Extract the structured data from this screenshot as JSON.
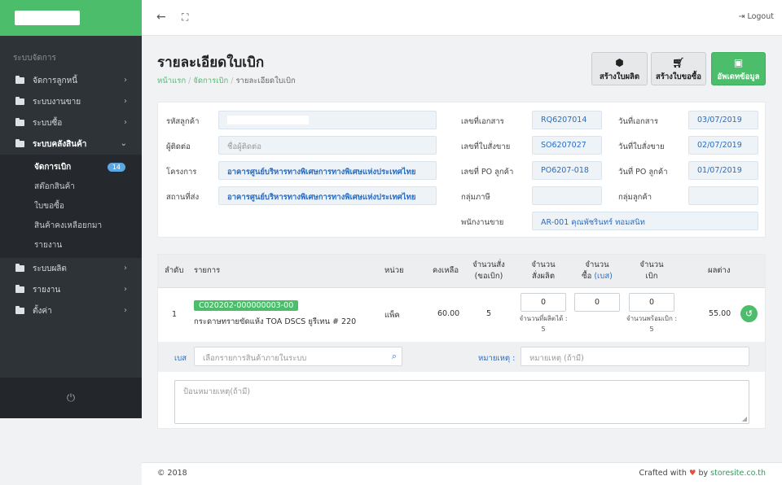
{
  "sidebar": {
    "heading": "ระบบจัดการ",
    "items": [
      {
        "label": "จัดการลูกหนี้"
      },
      {
        "label": "ระบบงานขาย"
      },
      {
        "label": "ระบบซื้อ"
      },
      {
        "label": "ระบบคลังสินค้า"
      },
      {
        "label": "ระบบผลิต"
      },
      {
        "label": "รายงาน"
      },
      {
        "label": "ตั้งค่า"
      }
    ],
    "subitems": [
      {
        "label": "จัดการเบิก",
        "badge": "14"
      },
      {
        "label": "สต๊อกสินค้า"
      },
      {
        "label": "ใบขอซื้อ"
      },
      {
        "label": "สินค้าคงเหลือยกมา"
      },
      {
        "label": "รายงาน"
      }
    ]
  },
  "topbar": {
    "logout": "Logout"
  },
  "page": {
    "title": "รายละเอียดใบเบิก",
    "breadcrumb": [
      "หน้าแรก",
      "จัดการเบิก",
      "รายละเอียดใบเบิก"
    ],
    "buttons": {
      "create_production": "สร้างใบผลิต",
      "create_purchase": "สร้างใบขอซื้อ",
      "update": "อัพเดทข้อมูล"
    }
  },
  "form": {
    "customer_code_label": "รหัสลูกค้า",
    "contact_label": "ผู้ติดต่อ",
    "contact_placeholder": "ชื่อผู้ติดต่อ",
    "project_label": "โครงการ",
    "project_value": "อาคารศูนย์บริหารทางพิเศษการทางพิเศษแห่งประเทศไทย",
    "ship_label": "สถานที่ส่ง",
    "ship_value": "อาคารศูนย์บริหารทางพิเศษการทางพิเศษแห่งประเทศไทย",
    "doc_no_label": "เลขที่เอกสาร",
    "doc_no": "RQ6207014",
    "doc_date_label": "วันที่เอกสาร",
    "doc_date": "03/07/2019",
    "so_no_label": "เลขที่ใบสั่งขาย",
    "so_no": "SO6207027",
    "so_date_label": "วันที่ใบสั่งขาย",
    "so_date": "02/07/2019",
    "po_no_label": "เลขที่ PO ลูกค้า",
    "po_no": "PO6207-018",
    "po_date_label": "วันที่ PO ลูกค้า",
    "po_date": "01/07/2019",
    "tax_group_label": "กลุ่มภาษี",
    "customer_group_label": "กลุ่มลูกค้า",
    "salesperson_label": "พนักงานขาย",
    "salesperson": "AR-001 คุณพัชรินทร์ ทอมสนิท"
  },
  "table": {
    "headers": {
      "no": "ลำดับ",
      "item": "รายการ",
      "unit": "หน่วย",
      "remaining": "คงเหลือ",
      "ordered_1": "จำนวนสั่ง",
      "ordered_2": "(ขอเบิก)",
      "produce_1": "จำนวน",
      "produce_2": "สั่งผลิต",
      "buy_1": "จำนวน",
      "buy_2": "ซื้อ",
      "buy_3": "(เบส)",
      "withdraw_1": "จำนวน",
      "withdraw_2": "เบิก",
      "diff": "ผลต่าง"
    },
    "rows": [
      {
        "no": "1",
        "code": "C020202-000000003-00",
        "name": "กระดาษทรายขัดแห้ง TOA DSCS ยูรีเทน # 220",
        "unit": "แพ็ค",
        "remaining": "60.00",
        "ordered": "5",
        "produce": "0",
        "produce_note_1": "จำนวนที่ผลิตได้ :",
        "produce_note_2": "5",
        "buy": "0",
        "withdraw": "0",
        "withdraw_note_1": "จำนวนพร้อมเบิก :",
        "withdraw_note_2": "5",
        "diff": "55.00"
      }
    ]
  },
  "add_row": {
    "label": "เบส",
    "search_placeholder": "เลือกรายการสินค้าภายในระบบ",
    "remark_label": "หมายเหตุ :",
    "remark_placeholder": "หมายเหตุ (ถ้ามี)"
  },
  "note_placeholder": "ป้อนหมายเหตุ(ถ้ามี)",
  "footer": {
    "copyright": "© 2018",
    "crafted": "Crafted with",
    "by": "by",
    "site": "storesite.co.th"
  },
  "colors": {
    "brand": "#4cbe6b",
    "sidebar": "#2e3338",
    "link": "#2a6cc0"
  }
}
